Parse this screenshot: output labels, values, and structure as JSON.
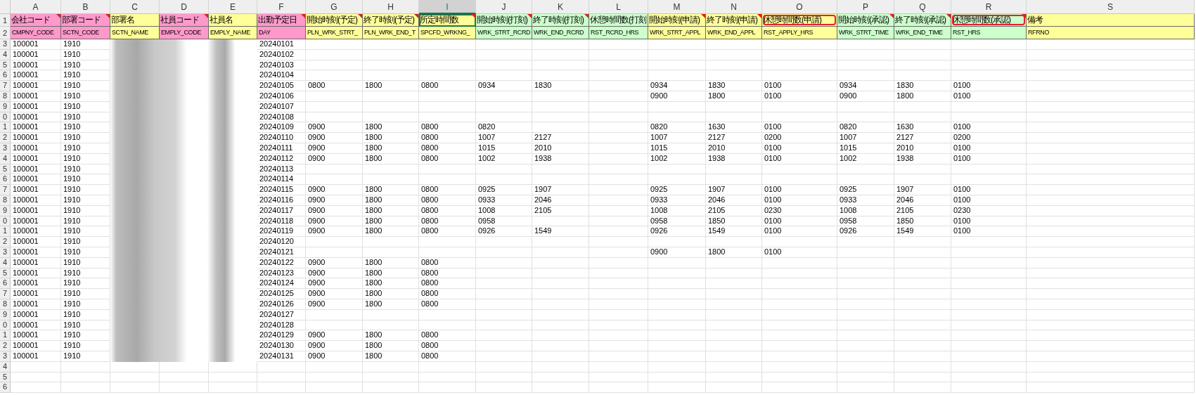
{
  "columns": [
    {
      "letter": "A",
      "selected": false,
      "title": "会社コード",
      "field": "CMPNY_CODE",
      "color": "#ff99cc",
      "comment": true,
      "highlighted": false
    },
    {
      "letter": "B",
      "selected": false,
      "title": "部署コード",
      "field": "SCTN_CODE",
      "color": "#ff99cc",
      "comment": true,
      "highlighted": false
    },
    {
      "letter": "C",
      "selected": false,
      "title": "部署名",
      "field": "SCTN_NAME",
      "color": "#ffff99",
      "comment": false,
      "highlighted": false
    },
    {
      "letter": "D",
      "selected": false,
      "title": "社員コード",
      "field": "EMPLY_CODE",
      "color": "#ff99cc",
      "comment": true,
      "highlighted": false
    },
    {
      "letter": "E",
      "selected": false,
      "title": "社員名",
      "field": "EMPLY_NAME",
      "color": "#ffff99",
      "comment": false,
      "highlighted": false
    },
    {
      "letter": "F",
      "selected": false,
      "title": "出勤予定日",
      "field": "DAY",
      "color": "#ff99cc",
      "comment": true,
      "highlighted": false
    },
    {
      "letter": "G",
      "selected": false,
      "title": "開始時刻(予定)",
      "field": "PLN_WRK_STRT_",
      "color": "#ffff99",
      "comment": true,
      "highlighted": false
    },
    {
      "letter": "H",
      "selected": false,
      "title": "終了時刻(予定)",
      "field": "PLN_WRK_END_T",
      "color": "#ffff99",
      "comment": true,
      "highlighted": false
    },
    {
      "letter": "I",
      "selected": true,
      "title": "所定時間数",
      "field": "SPCFD_WRKNG_",
      "color": "#ffff99",
      "comment": true,
      "highlighted": false
    },
    {
      "letter": "J",
      "selected": false,
      "title": "開始時刻(打刻)",
      "field": "WRK_STRT_RCRD",
      "color": "#ccffcc",
      "comment": true,
      "highlighted": false
    },
    {
      "letter": "K",
      "selected": false,
      "title": "終了時刻(打刻)",
      "field": "WRK_END_RCRD",
      "color": "#ccffcc",
      "comment": true,
      "highlighted": false
    },
    {
      "letter": "L",
      "selected": false,
      "title": "休憩時間数(打刻",
      "field": "RST_RCRD_HRS",
      "color": "#ccffcc",
      "comment": false,
      "highlighted": false
    },
    {
      "letter": "M",
      "selected": false,
      "title": "開始時刻(申請)",
      "field": "WRK_STRT_APPL",
      "color": "#ffff99",
      "comment": true,
      "highlighted": false
    },
    {
      "letter": "N",
      "selected": false,
      "title": "終了時刻(申請)",
      "field": "WRK_END_APPL",
      "color": "#ffff99",
      "comment": true,
      "highlighted": false
    },
    {
      "letter": "O",
      "selected": false,
      "title": "休憩時間数(申請)",
      "field": "RST_APPLY_HRS",
      "color": "#ffff99",
      "comment": false,
      "highlighted": true
    },
    {
      "letter": "P",
      "selected": false,
      "title": "開始時刻(承認)",
      "field": "WRK_STRT_TIME",
      "color": "#ccffcc",
      "comment": true,
      "highlighted": false
    },
    {
      "letter": "Q",
      "selected": false,
      "title": "終了時刻(承認)",
      "field": "WRK_END_TIME",
      "color": "#ccffcc",
      "comment": true,
      "highlighted": false
    },
    {
      "letter": "R",
      "selected": false,
      "title": "休憩時間数(承認)",
      "field": "RST_HRS",
      "color": "#ccffcc",
      "comment": true,
      "highlighted": true
    },
    {
      "letter": "S",
      "selected": false,
      "title": "備考",
      "field": "RFRNO",
      "color": "#ffff99",
      "comment": false,
      "highlighted": false
    }
  ],
  "header_row_numbers": [
    "1",
    "2"
  ],
  "rows": [
    {
      "num": "3",
      "redacted": true,
      "cells": {
        "A": "100001",
        "B": "1910",
        "F": "20240101"
      }
    },
    {
      "num": "4",
      "redacted": true,
      "cells": {
        "A": "100001",
        "B": "1910",
        "F": "20240102"
      }
    },
    {
      "num": "5",
      "redacted": true,
      "cells": {
        "A": "100001",
        "B": "1910",
        "F": "20240103"
      }
    },
    {
      "num": "6",
      "redacted": true,
      "cells": {
        "A": "100001",
        "B": "1910",
        "F": "20240104"
      }
    },
    {
      "num": "7",
      "redacted": true,
      "cells": {
        "A": "100001",
        "B": "1910",
        "F": "20240105",
        "G": "0800",
        "H": "1800",
        "I": "0800",
        "J": "0934",
        "K": "1830",
        "M": "0934",
        "N": "1830",
        "O": "0100",
        "P": "0934",
        "Q": "1830",
        "R": "0100"
      }
    },
    {
      "num": "8",
      "redacted": true,
      "cells": {
        "A": "100001",
        "B": "1910",
        "F": "20240106",
        "M": "0900",
        "N": "1800",
        "O": "0100",
        "P": "0900",
        "Q": "1800",
        "R": "0100"
      }
    },
    {
      "num": "9",
      "redacted": true,
      "cells": {
        "A": "100001",
        "B": "1910",
        "F": "20240107"
      }
    },
    {
      "num": "0",
      "redacted": true,
      "cells": {
        "A": "100001",
        "B": "1910",
        "F": "20240108"
      }
    },
    {
      "num": "1",
      "redacted": true,
      "cells": {
        "A": "100001",
        "B": "1910",
        "F": "20240109",
        "G": "0900",
        "H": "1800",
        "I": "0800",
        "J": "0820",
        "M": "0820",
        "N": "1630",
        "O": "0100",
        "P": "0820",
        "Q": "1630",
        "R": "0100"
      }
    },
    {
      "num": "2",
      "redacted": true,
      "cells": {
        "A": "100001",
        "B": "1910",
        "F": "20240110",
        "G": "0900",
        "H": "1800",
        "I": "0800",
        "J": "1007",
        "K": "2127",
        "M": "1007",
        "N": "2127",
        "O": "0200",
        "P": "1007",
        "Q": "2127",
        "R": "0200"
      }
    },
    {
      "num": "3",
      "redacted": true,
      "cells": {
        "A": "100001",
        "B": "1910",
        "F": "20240111",
        "G": "0900",
        "H": "1800",
        "I": "0800",
        "J": "1015",
        "K": "2010",
        "M": "1015",
        "N": "2010",
        "O": "0100",
        "P": "1015",
        "Q": "2010",
        "R": "0100"
      }
    },
    {
      "num": "4",
      "redacted": true,
      "cells": {
        "A": "100001",
        "B": "1910",
        "F": "20240112",
        "G": "0900",
        "H": "1800",
        "I": "0800",
        "J": "1002",
        "K": "1938",
        "M": "1002",
        "N": "1938",
        "O": "0100",
        "P": "1002",
        "Q": "1938",
        "R": "0100"
      }
    },
    {
      "num": "5",
      "redacted": true,
      "cells": {
        "A": "100001",
        "B": "1910",
        "F": "20240113"
      }
    },
    {
      "num": "6",
      "redacted": true,
      "cells": {
        "A": "100001",
        "B": "1910",
        "F": "20240114"
      }
    },
    {
      "num": "7",
      "redacted": true,
      "cells": {
        "A": "100001",
        "B": "1910",
        "F": "20240115",
        "G": "0900",
        "H": "1800",
        "I": "0800",
        "J": "0925",
        "K": "1907",
        "M": "0925",
        "N": "1907",
        "O": "0100",
        "P": "0925",
        "Q": "1907",
        "R": "0100"
      }
    },
    {
      "num": "8",
      "redacted": true,
      "cells": {
        "A": "100001",
        "B": "1910",
        "F": "20240116",
        "G": "0900",
        "H": "1800",
        "I": "0800",
        "J": "0933",
        "K": "2046",
        "M": "0933",
        "N": "2046",
        "O": "0100",
        "P": "0933",
        "Q": "2046",
        "R": "0100"
      }
    },
    {
      "num": "9",
      "redacted": true,
      "cells": {
        "A": "100001",
        "B": "1910",
        "F": "20240117",
        "G": "0900",
        "H": "1800",
        "I": "0800",
        "J": "1008",
        "K": "2105",
        "M": "1008",
        "N": "2105",
        "O": "0230",
        "P": "1008",
        "Q": "2105",
        "R": "0230"
      }
    },
    {
      "num": "0",
      "redacted": true,
      "cells": {
        "A": "100001",
        "B": "1910",
        "F": "20240118",
        "G": "0900",
        "H": "1800",
        "I": "0800",
        "J": "0958",
        "M": "0958",
        "N": "1850",
        "O": "0100",
        "P": "0958",
        "Q": "1850",
        "R": "0100"
      }
    },
    {
      "num": "1",
      "redacted": true,
      "cells": {
        "A": "100001",
        "B": "1910",
        "F": "20240119",
        "G": "0900",
        "H": "1800",
        "I": "0800",
        "J": "0926",
        "K": "1549",
        "M": "0926",
        "N": "1549",
        "O": "0100",
        "P": "0926",
        "Q": "1549",
        "R": "0100"
      }
    },
    {
      "num": "2",
      "redacted": true,
      "cells": {
        "A": "100001",
        "B": "1910",
        "F": "20240120"
      }
    },
    {
      "num": "3",
      "redacted": true,
      "cells": {
        "A": "100001",
        "B": "1910",
        "F": "20240121",
        "M": "0900",
        "N": "1800",
        "O": "0100"
      }
    },
    {
      "num": "4",
      "redacted": true,
      "cells": {
        "A": "100001",
        "B": "1910",
        "F": "20240122",
        "G": "0900",
        "H": "1800",
        "I": "0800"
      }
    },
    {
      "num": "5",
      "redacted": true,
      "cells": {
        "A": "100001",
        "B": "1910",
        "F": "20240123",
        "G": "0900",
        "H": "1800",
        "I": "0800"
      }
    },
    {
      "num": "6",
      "redacted": true,
      "cells": {
        "A": "100001",
        "B": "1910",
        "F": "20240124",
        "G": "0900",
        "H": "1800",
        "I": "0800"
      }
    },
    {
      "num": "7",
      "redacted": true,
      "cells": {
        "A": "100001",
        "B": "1910",
        "F": "20240125",
        "G": "0900",
        "H": "1800",
        "I": "0800"
      }
    },
    {
      "num": "8",
      "redacted": true,
      "cells": {
        "A": "100001",
        "B": "1910",
        "F": "20240126",
        "G": "0900",
        "H": "1800",
        "I": "0800"
      }
    },
    {
      "num": "9",
      "redacted": true,
      "cells": {
        "A": "100001",
        "B": "1910",
        "F": "20240127"
      }
    },
    {
      "num": "0",
      "redacted": true,
      "cells": {
        "A": "100001",
        "B": "1910",
        "F": "20240128"
      }
    },
    {
      "num": "1",
      "redacted": true,
      "cells": {
        "A": "100001",
        "B": "1910",
        "F": "20240129",
        "G": "0900",
        "H": "1800",
        "I": "0800"
      }
    },
    {
      "num": "2",
      "redacted": true,
      "cells": {
        "A": "100001",
        "B": "1910",
        "F": "20240130",
        "G": "0900",
        "H": "1800",
        "I": "0800"
      }
    },
    {
      "num": "3",
      "redacted": true,
      "cells": {
        "A": "100001",
        "B": "1910",
        "F": "20240131",
        "G": "0900",
        "H": "1800",
        "I": "0800"
      }
    },
    {
      "num": "4",
      "redacted": false,
      "cells": {}
    },
    {
      "num": "5",
      "redacted": false,
      "cells": {}
    },
    {
      "num": "6",
      "redacted": false,
      "cells": {}
    }
  ]
}
